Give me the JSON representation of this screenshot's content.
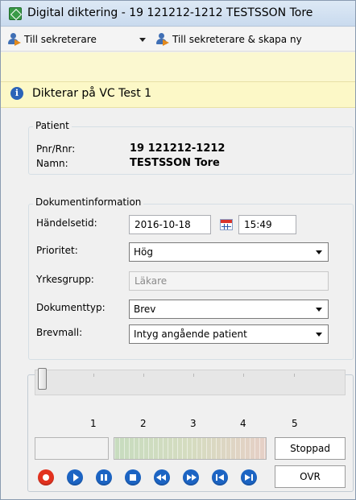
{
  "window": {
    "title": "Digital diktering - 19 121212-1212 TESTSSON Tore"
  },
  "toolbar": {
    "send_label": "Till sekreterare",
    "send_new_label": "Till sekreterare & skapa ny"
  },
  "info": {
    "message": "Dikterar på VC Test 1"
  },
  "patient": {
    "group_title": "Patient",
    "pnr_label": "Pnr/Rnr:",
    "pnr_value": "19  121212-1212",
    "name_label": "Namn:",
    "name_value": "TESTSSON Tore"
  },
  "document": {
    "group_title": "Dokumentinformation",
    "event_time_label": "Händelsetid:",
    "event_date": "2016-10-18",
    "event_time": "15:49",
    "priority_label": "Prioritet:",
    "priority_value": "Hög",
    "profession_label": "Yrkesgrupp:",
    "profession_value": "Läkare",
    "doctype_label": "Dokumenttyp:",
    "doctype_value": "Brev",
    "template_label": "Brevmall:",
    "template_value": "Intyg angående patient"
  },
  "player": {
    "scale": [
      "1",
      "2",
      "3",
      "4",
      "5"
    ],
    "status": "Stoppad",
    "mode": "OVR",
    "position_fraction": 0.0,
    "buttons": [
      "record-icon",
      "play-icon",
      "pause-icon",
      "stop-icon",
      "rewind-icon",
      "fast-forward-icon",
      "skip-start-icon",
      "skip-end-icon"
    ]
  },
  "colors": {
    "info_bar": "#fcf8c7",
    "record": "#e2321f",
    "transport": "#1c64c3"
  }
}
